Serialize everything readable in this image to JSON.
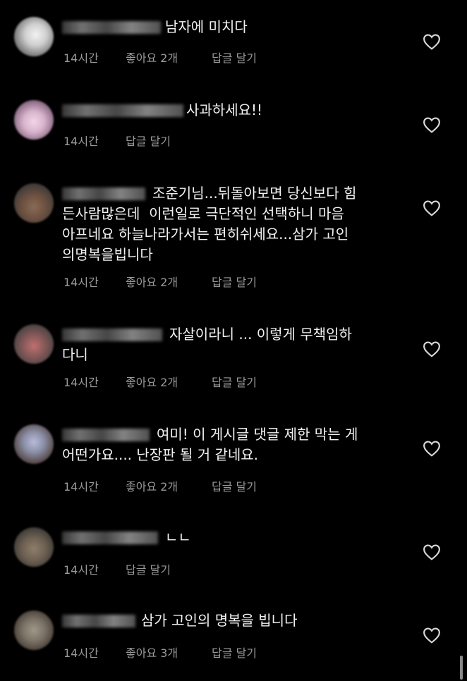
{
  "comments": [
    {
      "text": "남자에 미치다",
      "time": "14시간",
      "likes": "좋아요 2개",
      "reply": "답글 달기",
      "avatar_color": "#d8d8d8"
    },
    {
      "text": "사과하세요!!",
      "time": "14시간",
      "likes": "",
      "reply": "답글 달기",
      "avatar_color": "#d6b8cf"
    },
    {
      "text": "조준기님...뒤돌아보면 당신보다 힘\n든사람많은데  이런일로 극단적인 선택하니 마음\n아프네요 하늘나라가서는 편히쉬세요...삼가 고인\n의명복을빕니다",
      "time": "14시간",
      "likes": "좋아요 2개",
      "reply": "답글 달기",
      "avatar_color": "#6b5040"
    },
    {
      "text": "자살이라니 ... 이렇게 무책임하\n다니",
      "time": "14시간",
      "likes": "좋아요 2개",
      "reply": "답글 달기",
      "avatar_color": "#8a5a5a"
    },
    {
      "text": "여미! 이 게시글 댓글 제한 막는 게\n어떤가요.... 난장판 될 거 같네요.",
      "time": "14시간",
      "likes": "좋아요 2개",
      "reply": "답글 달기",
      "avatar_color": "#8b8fa8"
    },
    {
      "text": "ㄴㄴ",
      "time": "14시간",
      "likes": "",
      "reply": "답글 달기",
      "avatar_color": "#6d6052"
    },
    {
      "text": "삼가 고인의 명복을 빕니다",
      "time": "14시간",
      "likes": "좋아요 3개",
      "reply": "답글 달기",
      "avatar_color": "#7a7266"
    }
  ],
  "icons": {
    "like": "heart-outline-icon"
  },
  "colors": {
    "background": "#000000",
    "text": "#f2f2f2",
    "meta": "#9a9a9a"
  }
}
